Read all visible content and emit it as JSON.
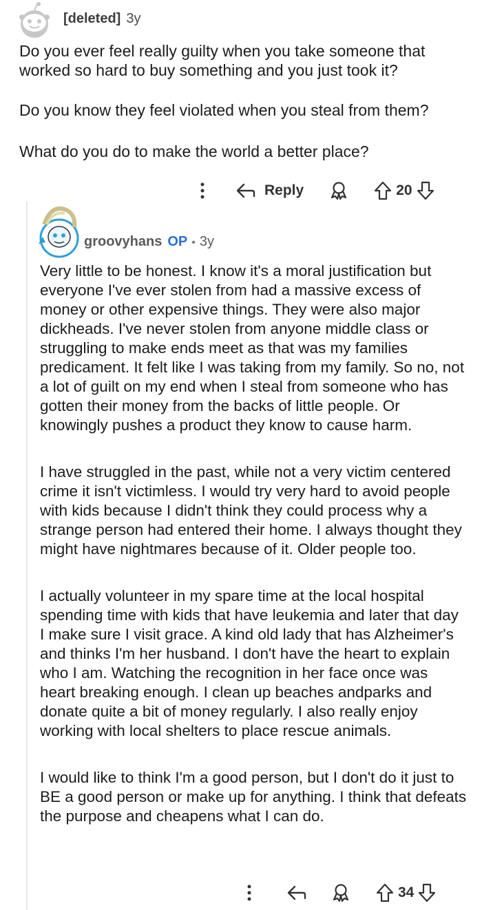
{
  "parent_comment": {
    "author": "[deleted]",
    "age": "3y",
    "paragraphs": [
      "Do you ever feel really guilty when you take someone that worked so hard to buy something and you just took it?",
      "Do you know they feel violated when you steal from them?",
      "What do you do to make the world a better place?"
    ],
    "actions": {
      "reply_label": "Reply",
      "vote_count": "20"
    }
  },
  "reply_comment": {
    "author": "groovyhans",
    "op_badge": "OP",
    "separator": "•",
    "age": "3y",
    "paragraphs": [
      "Very little to be honest. I know it's a moral justification but everyone I've ever stolen from had a massive excess of money or other expensive things. They were also major dickheads. I've never stolen from anyone middle class or struggling to make ends meet as that was my families predicament. It felt like I was taking from my family. So no, not a lot of guilt on my end when I steal from someone who has gotten their money from the backs of little people. Or knowingly pushes a product they know to cause harm.",
      "I have struggled in the past, while not a very victim centered crime it isn't victimless. I would try very hard to avoid people with kids because I didn't think they could process why a strange person had entered their home. I always thought they might have nightmares because of it. Older people too.",
      "I actually volunteer in my spare time at the local hospital spending time with kids that have leukemia and later that day I make sure I visit grace. A kind old lady that has Alzheimer's and thinks I'm her husband. I don't have the heart to explain who I am. Watching the recognition in her face once was heart breaking enough. I clean up beaches andparks and donate quite a bit of money regularly. I also really enjoy working with local shelters to place rescue animals.",
      "I would like to think I'm a good person, but I don't do it just to BE a good person or make up for anything. I think that defeats the purpose and cheapens what I can do."
    ],
    "actions": {
      "vote_count": "34"
    }
  },
  "icons": {
    "more": "more-vertical-icon",
    "reply": "reply-arrow-icon",
    "award": "award-icon",
    "upvote": "upvote-arrow-icon",
    "downvote": "downvote-arrow-icon"
  }
}
